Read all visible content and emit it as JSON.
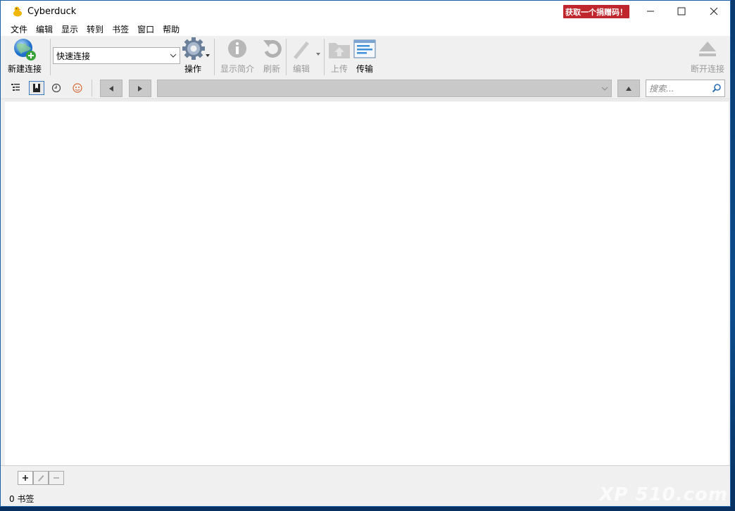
{
  "window": {
    "title": "Cyberduck",
    "donate_label": "获取一个捐赠码！"
  },
  "menu": [
    "文件",
    "编辑",
    "显示",
    "转到",
    "书签",
    "窗口",
    "帮助"
  ],
  "toolbar": {
    "new_connection": "新建连接",
    "quick_connect": "快速连接",
    "action": "操作",
    "get_info": "显示简介",
    "refresh": "刷新",
    "edit": "编辑",
    "upload": "上传",
    "transfers": "传输",
    "disconnect": "断开连接"
  },
  "navbar": {
    "search_placeholder": "搜索..."
  },
  "status": {
    "text": "0 书签"
  },
  "watermark": {
    "text": "XP 510.com"
  },
  "colors": {
    "donate_bg": "#c0272d",
    "accent": "#3b78c4"
  }
}
